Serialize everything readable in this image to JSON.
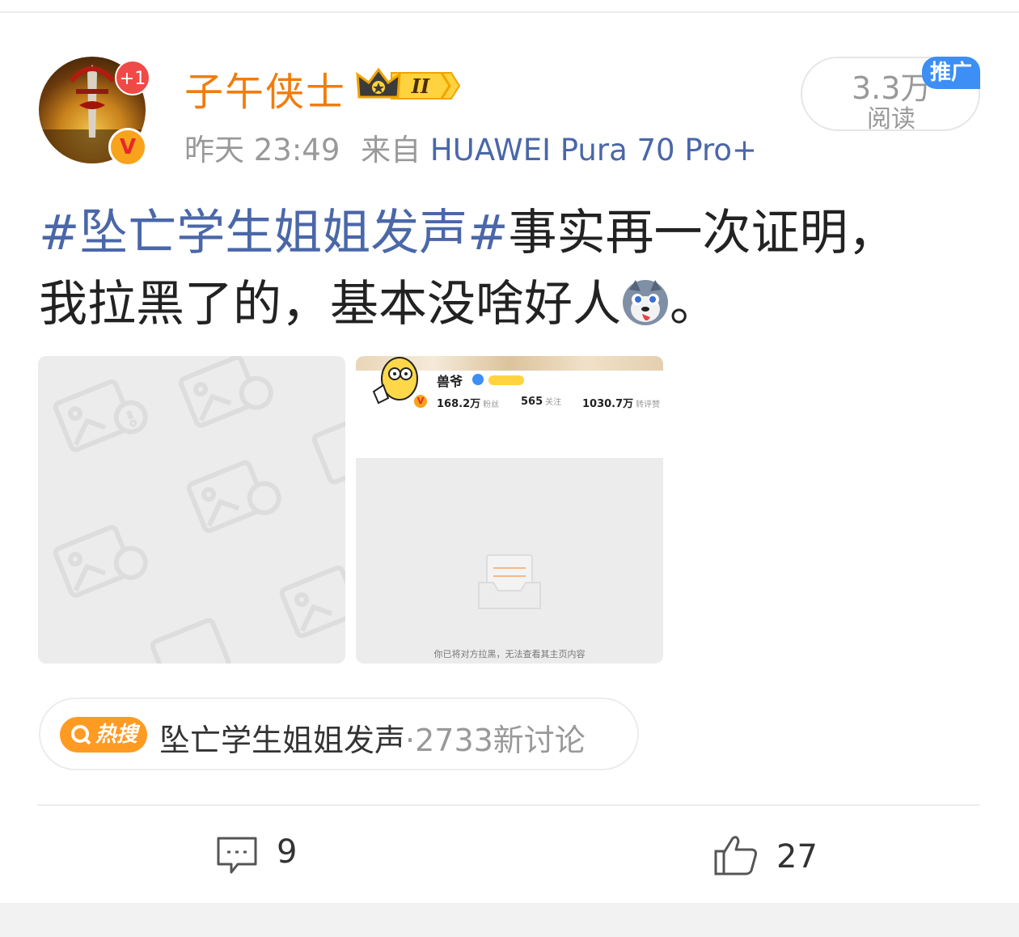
{
  "author": {
    "name": "子午侠士",
    "notification_badge": "+1",
    "verified_badge": "V",
    "level_badge": "II"
  },
  "post_meta": {
    "time": "昨天 23:49",
    "source_prefix": "来自",
    "device": "HUAWEI Pura 70 Pro+"
  },
  "read_stats": {
    "count": "3.3万",
    "label": "阅读",
    "promo_tag": "推广"
  },
  "post": {
    "topic": "#坠亡学生姐姐发声#",
    "text": "事实再一次证明，我拉黑了的，基本没啥好人",
    "text_end": "。",
    "emoji": "husky-emoji-icon"
  },
  "images": {
    "second": {
      "profile_name": "兽爷",
      "stats": [
        {
          "value": "168.2万",
          "unit": "粉丝"
        },
        {
          "value": "565",
          "unit": "关注"
        },
        {
          "value": "1030.7万",
          "unit": "转评赞"
        }
      ],
      "blocked_message": "你已将对方拉黑，无法查看其主页内容"
    }
  },
  "hot_search": {
    "badge_label": "热搜",
    "topic": "坠亡学生姐姐发声",
    "count": "·2733新讨论"
  },
  "actions": {
    "comments": "9",
    "likes": "27"
  },
  "colors": {
    "username": "#f07d0d",
    "link": "#4a67a8",
    "hot_badge": "#ff9a22",
    "promo": "#3d8ef5"
  }
}
